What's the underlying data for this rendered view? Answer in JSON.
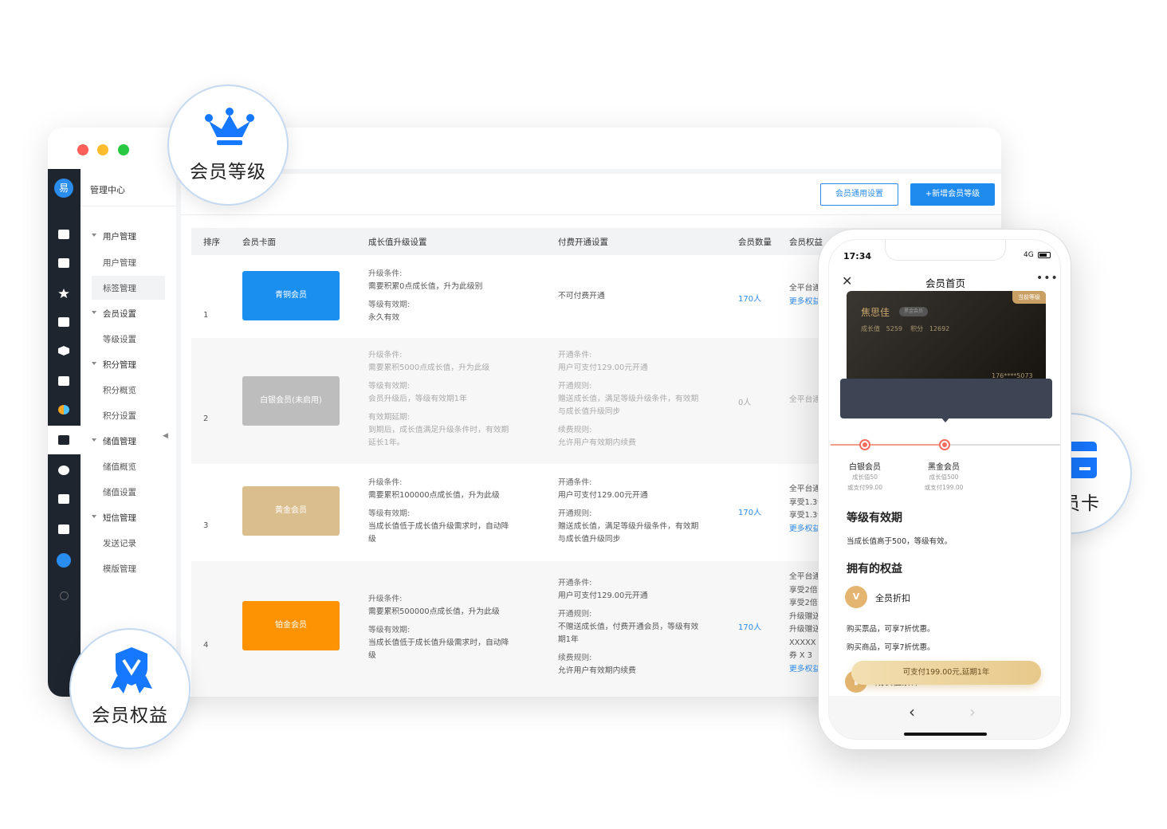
{
  "admin": {
    "logo_char": "易",
    "menu_title": "管理中心",
    "menu": [
      {
        "label": "用户管理",
        "type": "group"
      },
      {
        "label": "用户管理",
        "type": "item"
      },
      {
        "label": "标签管理",
        "type": "item",
        "selected": true
      },
      {
        "label": "会员设置",
        "type": "group"
      },
      {
        "label": "等级设置",
        "type": "item"
      },
      {
        "label": "积分管理",
        "type": "group"
      },
      {
        "label": "积分概览",
        "type": "item"
      },
      {
        "label": "积分设置",
        "type": "item"
      },
      {
        "label": "储值管理",
        "type": "group"
      },
      {
        "label": "储值概览",
        "type": "item"
      },
      {
        "label": "储值设置",
        "type": "item"
      },
      {
        "label": "短信管理",
        "type": "group"
      },
      {
        "label": "发送记录",
        "type": "item"
      },
      {
        "label": "模版管理",
        "type": "item"
      }
    ],
    "buttons": {
      "settings": "会员通用设置",
      "add": "+新增会员等级"
    },
    "columns": [
      "排序",
      "会员卡面",
      "成长值升级设置",
      "付费开通设置",
      "会员数量",
      "会员权益"
    ],
    "rows": [
      {
        "index": "1",
        "card": "青铜会员",
        "card_color": "#1a8ff0",
        "growth": [
          "升级条件:",
          "需要积累0点成长值，升为此级别",
          "等级有效期:",
          "永久有效"
        ],
        "pay": [
          "不可付费开通"
        ],
        "count": "170人",
        "rights": [
          "全平台通用",
          "更多权益"
        ]
      },
      {
        "index": "2",
        "card": "白银会员(未启用)",
        "card_color": "#bdbdbd",
        "growth": [
          "升级条件:",
          "需要累积5000点成长值，升为此级",
          "等级有效期:",
          "会员升级后，等级有效期1年",
          "有效期延期:",
          "到期后，成长值满足升级条件时，有效期",
          "延长1年。"
        ],
        "pay": [
          "开通条件:",
          "用户可支付129.00元开通",
          "开通规则:",
          "赠送成长值，满足等级升级条件，有效期",
          "与成长值升级同步",
          "续费规则:",
          "允许用户有效期内续费"
        ],
        "count": "0人",
        "rights": [
          "全平台通用"
        ]
      },
      {
        "index": "3",
        "card": "黄金会员",
        "card_color": "#dbbe8e",
        "growth": [
          "升级条件:",
          "需要累积100000点成长值，升为此级",
          "等级有效期:",
          "当成长值低于成长值升级需求时，自动降",
          "级"
        ],
        "pay": [
          "开通条件:",
          "用户可支付129.00元开通",
          "开通规则:",
          "赠送成长值，满足等级升级条件，有效期",
          "与成长值升级同步"
        ],
        "count": "170人",
        "rights": [
          "全平台通用",
          "享受1.3倍",
          "享受1.3倍",
          "更多权益"
        ]
      },
      {
        "index": "4",
        "card": "铂金会员",
        "card_color": "#fd9202",
        "growth": [
          "升级条件:",
          "需要累积500000点成长值，升为此级",
          "等级有效期:",
          "当成长值低于成长值升级需求时，自动降",
          "级"
        ],
        "pay": [
          "开通条件:",
          "用户可支付129.00元开通",
          "开通规则:",
          "不赠送成长值，付费开通会员，等级有效",
          "期1年",
          "续费规则:",
          "允许用户有效期内续费"
        ],
        "count": "170人",
        "rights": [
          "全平台通用",
          "享受2倍",
          "享受2倍",
          "升级赠送",
          "升级赠送",
          "XXXXX",
          "券 X 3",
          "更多权益"
        ]
      }
    ]
  },
  "badges": {
    "level": "会员等级",
    "card": "会员卡",
    "rights": "会员权益"
  },
  "phone": {
    "time": "17:34",
    "network": "4G",
    "title": "会员首页",
    "card": {
      "tag": "当前等级",
      "name": "焦思佳",
      "level": "黑金会员",
      "growth_label": "成长值",
      "growth": "5259",
      "points_label": "积分",
      "points": "12692",
      "phone": "176****5073"
    },
    "levels": [
      {
        "name": "白银会员",
        "line1": "成长值50",
        "line2": "或支付99.00"
      },
      {
        "name": "黑金会员",
        "line1": "成长值500",
        "line2": "或支付199.00"
      }
    ],
    "validity_title": "等级有效期",
    "validity_text": "当成长值高于500，等级有效。",
    "rights_title": "拥有的权益",
    "right1": "全员折扣",
    "right1_desc1": "购买票品，可享7折优惠。",
    "right1_desc2": "购买商品，可享7折优惠。",
    "right2": "成长值累计",
    "pay_button": "可支付199.00元,延期1年"
  }
}
